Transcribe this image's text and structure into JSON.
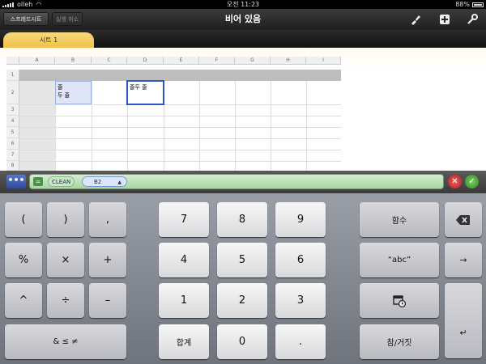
{
  "status": {
    "carrier": "olleh",
    "time": "오전 11:23",
    "battery": "88%"
  },
  "toolbar": {
    "spreadsheets_label": "스프레드시트",
    "undo_label": "실행 취소",
    "title": "비어 있음"
  },
  "tabs": [
    {
      "label": "시트 1"
    }
  ],
  "sheet": {
    "columns": [
      "A",
      "B",
      "C",
      "D",
      "E",
      "F",
      "G",
      "H",
      "I"
    ],
    "rows": [
      "1",
      "2",
      "3",
      "4",
      "5",
      "6",
      "7",
      "8"
    ],
    "cells": {
      "B2_line1": "줄",
      "B2_line2": "두 줄",
      "D2": "줄두 줄"
    }
  },
  "formula": {
    "function": "CLEAN",
    "reference": "B2"
  },
  "keyboard": {
    "keys": [
      "(",
      ")",
      ",",
      "7",
      "8",
      "9",
      "함수",
      "%",
      "×",
      "+",
      "4",
      "5",
      "6",
      "“abc”",
      "^",
      "÷",
      "–",
      "1",
      "2",
      "3",
      "& ≤ ≠",
      "합계",
      "0",
      ".",
      "참/거짓"
    ]
  }
}
